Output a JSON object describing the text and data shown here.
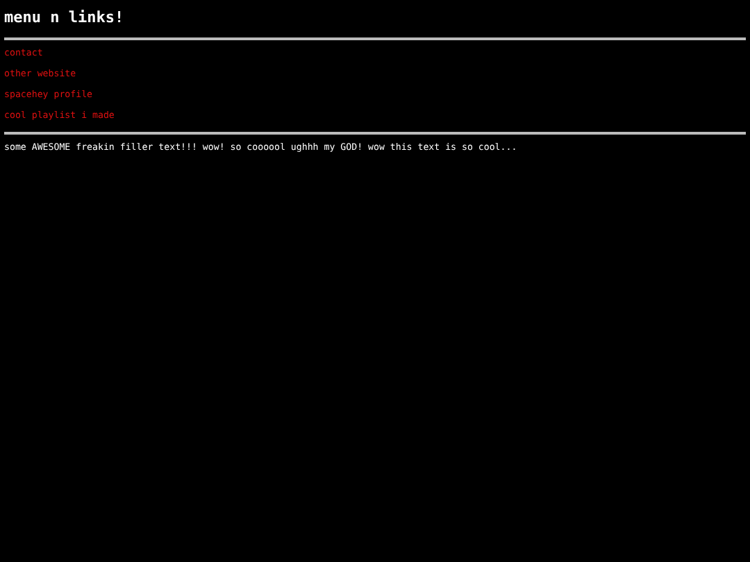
{
  "title": "menu n links!",
  "links": [
    "contact",
    "other website",
    "spacehey profile",
    "cool playlist i made"
  ],
  "text": "some AWESOME freakin filler text!!! wow! so coooool ughhh my GOD! wow this text is so cool..."
}
